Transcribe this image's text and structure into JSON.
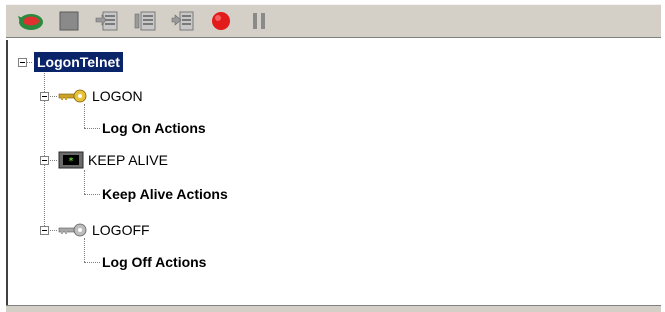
{
  "toolbar": {
    "buttons": [
      {
        "icon": "refresh-arrow-icon"
      },
      {
        "icon": "stop-square-icon"
      },
      {
        "icon": "add-step-icon"
      },
      {
        "icon": "insert-step-icon"
      },
      {
        "icon": "move-step-icon"
      },
      {
        "icon": "record-icon"
      },
      {
        "icon": "pause-icon"
      }
    ]
  },
  "tree": {
    "root": {
      "label": "LogonTelnet"
    },
    "nodes": [
      {
        "label": "LOGON",
        "icon": "key-gold-icon",
        "child": "Log On Actions"
      },
      {
        "label": "KEEP ALIVE",
        "icon": "terminal-icon",
        "child": "Keep Alive Actions"
      },
      {
        "label": "LOGOFF",
        "icon": "key-gray-icon",
        "child": "Log Off Actions"
      }
    ]
  },
  "colors": {
    "selection": "#0a246a",
    "toolbar_bg": "#d4d0c8",
    "record": "#e21b1b"
  }
}
